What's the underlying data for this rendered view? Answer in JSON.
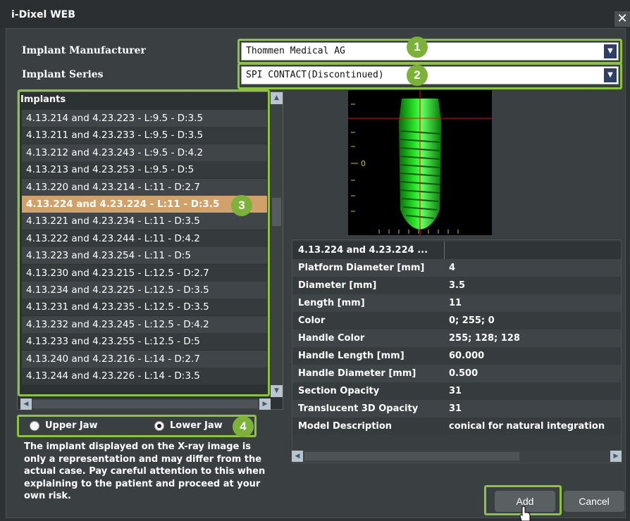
{
  "window": {
    "title": "i-Dixel WEB",
    "close_glyph": "✕"
  },
  "form": {
    "manufacturer_label": "Implant Manufacturer",
    "manufacturer_value": "Thommen Medical AG",
    "series_label": "Implant Series",
    "series_value": "SPI CONTACT(Discontinued)"
  },
  "badges": [
    "1",
    "2",
    "3",
    "4"
  ],
  "implants": {
    "header": "Implants",
    "items": [
      "4.13.214 and 4.23.223 - L:9.5 - D:3.5",
      "4.13.211 and 4.23.233 - L:9.5 - D:3.5",
      "4.13.212 and 4.23.243 - L:9.5 - D:4.2",
      "4.13.213 and 4.23.253 - L:9.5 - D:5",
      "4.13.220 and 4.23.214 - L:11 - D:2.7",
      "4.13.224 and 4.23.224 - L:11 - D:3.5",
      "4.13.221 and 4.23.234 - L:11 - D:3.5",
      "4.13.222 and 4.23.244 - L:11 - D:4.2",
      "4.13.223 and 4.23.254 - L:11 - D:5",
      "4.13.230 and 4.23.215 - L:12.5 - D:2.7",
      "4.13.234 and 4.23.225 - L:12.5 - D:3.5",
      "4.13.231 and 4.23.235 - L:12.5 - D:3.5",
      "4.13.232 and 4.23.245 - L:12.5 - D:4.2",
      "4.13.233 and 4.23.255 - L:12.5 - D:5",
      "4.13.240 and 4.23.216 - L:14 - D:2.7",
      "4.13.244 and 4.23.226 - L:14 - D:3.5"
    ],
    "selected_index": 5
  },
  "jaw": {
    "upper": "Upper Jaw",
    "lower": "Lower Jaw",
    "selected": "lower"
  },
  "note": "The implant displayed on the X-ray image is only a representation and may differ from the actual case. Pay careful attention to this when explaining to the patient and proceed at your own risk.",
  "preview": {
    "axis_label": "0",
    "implant_color": "#00ff00",
    "crosshair_color": "#ff0000"
  },
  "properties": {
    "title": "4.13.224 and 4.23.224 ...",
    "rows": [
      {
        "key": "Platform Diameter [mm]",
        "value": "4"
      },
      {
        "key": "Diameter [mm]",
        "value": "3.5"
      },
      {
        "key": "Length [mm]",
        "value": "11"
      },
      {
        "key": "Color",
        "value": "0; 255; 0"
      },
      {
        "key": "Handle Color",
        "value": "255; 128; 128"
      },
      {
        "key": "Handle Length [mm]",
        "value": "60.000"
      },
      {
        "key": "Handle Diameter [mm]",
        "value": "0.500"
      },
      {
        "key": "Section Opacity",
        "value": "31"
      },
      {
        "key": "Translucent 3D Opacity",
        "value": "31"
      },
      {
        "key": "Model Description",
        "value": "conical for natural integration"
      }
    ]
  },
  "buttons": {
    "add": "Add",
    "cancel": "Cancel"
  },
  "colors": {
    "highlight": "#8cc43c",
    "selected_row": "#d1a16a"
  }
}
